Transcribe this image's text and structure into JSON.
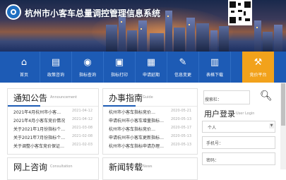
{
  "header": {
    "site_title": "杭州市小客车总量调控管理信息系统",
    "accent_color": "#1d5bb5",
    "active_color": "#f2a21b"
  },
  "nav": {
    "items": [
      {
        "label": "首页",
        "icon": "home-icon"
      },
      {
        "label": "政策咨询",
        "icon": "policy-icon"
      },
      {
        "label": "指标查询",
        "icon": "query-icon"
      },
      {
        "label": "指标打印",
        "icon": "print-icon"
      },
      {
        "label": "申请延期",
        "icon": "extend-icon"
      },
      {
        "label": "信息变更",
        "icon": "change-icon"
      },
      {
        "label": "表格下载",
        "icon": "download-icon"
      },
      {
        "label": "竞价平台",
        "icon": "auction-icon"
      }
    ]
  },
  "notice": {
    "title": "通知公告",
    "subtitle": "Announcement",
    "items": [
      {
        "text": "2021年4月杭州市小客…",
        "date": "2021-04-12"
      },
      {
        "text": "2021年4月小客车竞价情况",
        "date": "2021-04-12"
      },
      {
        "text": "关于2021年1月份指标个…",
        "date": "2021-03-08"
      },
      {
        "text": "关于2021年7月份指标个…",
        "date": "2021-02-08"
      },
      {
        "text": "关于调整小客车竞价保证…",
        "date": "2021-02-03"
      }
    ]
  },
  "guide": {
    "title": "办事指南",
    "subtitle": "Guide",
    "items": [
      {
        "text": "杭州市小客车指标竞价…",
        "date": "2020-05-21"
      },
      {
        "text": "申请杭州市小客车增量指标…",
        "date": "2020-05-13"
      },
      {
        "text": "杭州市小客车指标竞价…",
        "date": "2020-05-17"
      },
      {
        "text": "申请杭州市小客车更新指标…",
        "date": "2020-05-13"
      },
      {
        "text": "杭州市小客车指标申请办理…",
        "date": "2020-05-13"
      }
    ]
  },
  "consult": {
    "title": "网上咨询",
    "subtitle": "Consultation"
  },
  "news": {
    "title": "新闻转载",
    "subtitle": "News"
  },
  "search": {
    "label": "搜索栏："
  },
  "login": {
    "title": "用户登录",
    "subtitle": "User Login",
    "role": "个人",
    "phone_placeholder": "手机号：",
    "password_placeholder": "密码："
  }
}
